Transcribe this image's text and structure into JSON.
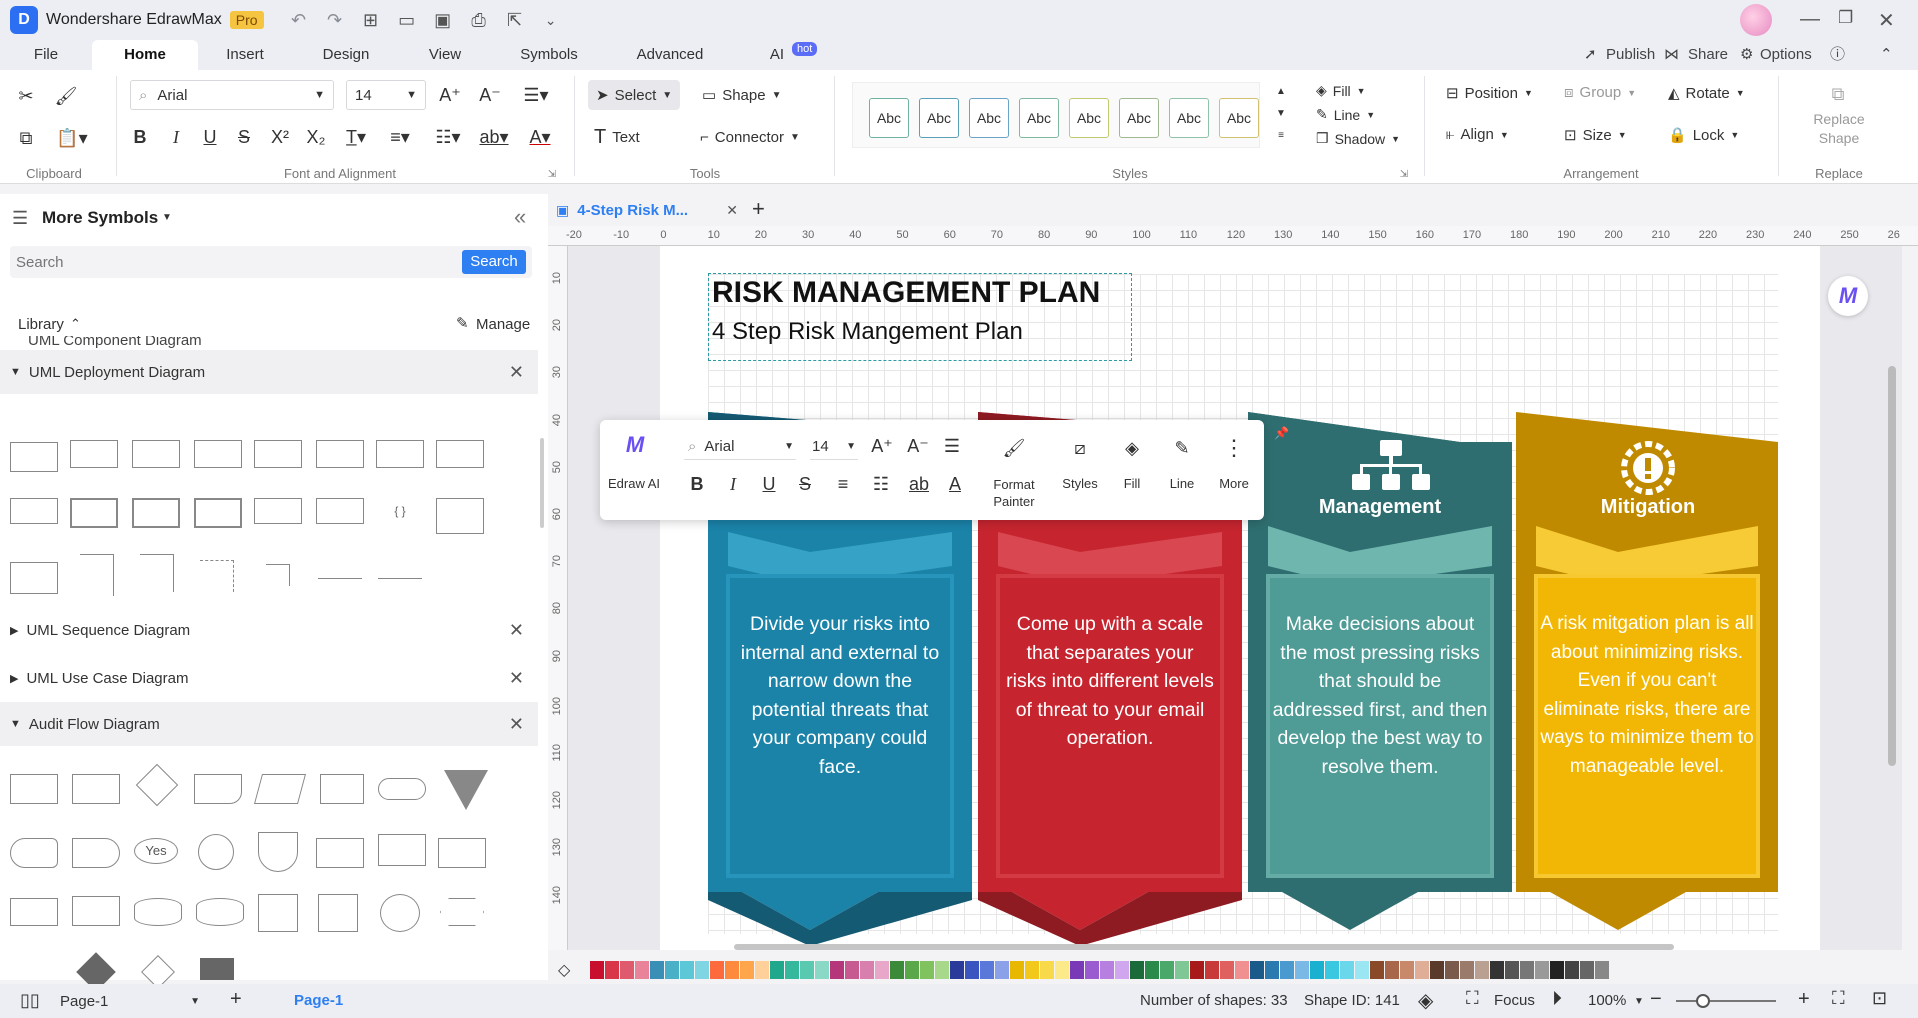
{
  "app": {
    "name": "Wondershare EdrawMax",
    "badge": "Pro"
  },
  "menu": {
    "tabs": [
      "File",
      "Home",
      "Insert",
      "Design",
      "View",
      "Symbols",
      "Advanced",
      "AI"
    ],
    "active": "Home",
    "ai_badge": "hot",
    "right": {
      "publish": "Publish",
      "share": "Share",
      "options": "Options"
    }
  },
  "ribbon": {
    "font_name": "Arial",
    "font_size": "14",
    "select": "Select",
    "shape": "Shape",
    "text": "Text",
    "connector": "Connector",
    "style_sample": "Abc",
    "fill": "Fill",
    "line": "Line",
    "shadow": "Shadow",
    "position": "Position",
    "group": "Group",
    "rotate": "Rotate",
    "align": "Align",
    "size": "Size",
    "lock": "Lock",
    "replace_shape": "Replace Shape",
    "groups": {
      "clipboard": "Clipboard",
      "font": "Font and Alignment",
      "tools": "Tools",
      "styles": "Styles",
      "arrangement": "Arrangement",
      "replace": "Replace"
    }
  },
  "left_panel": {
    "title": "More Symbols",
    "search_placeholder": "Search",
    "search_button": "Search",
    "library": "Library",
    "manage": "Manage",
    "partial_item": "UML Component Diagram",
    "categories": [
      {
        "label": "UML Deployment Diagram",
        "open": true
      },
      {
        "label": "UML Sequence Diagram",
        "open": false
      },
      {
        "label": "UML Use Case Diagram",
        "open": false
      },
      {
        "label": "Audit Flow Diagram",
        "open": true
      }
    ],
    "yes_shape": "Yes"
  },
  "document": {
    "tab_title": "4-Step Risk M...",
    "ruler_h": [
      "-20",
      "-10",
      "0",
      "10",
      "20",
      "30",
      "40",
      "50",
      "60",
      "70",
      "80",
      "90",
      "100",
      "110",
      "120",
      "130",
      "140",
      "150",
      "160",
      "170",
      "180",
      "190",
      "200",
      "210",
      "220",
      "230",
      "240",
      "250",
      "26"
    ],
    "ruler_v": [
      "10",
      "20",
      "30",
      "40",
      "50",
      "60",
      "70",
      "80",
      "90",
      "100",
      "110",
      "120",
      "130",
      "140"
    ],
    "title": "RISK MANAGEMENT PLAN",
    "subtitle": "4 Step Risk Mangement Plan",
    "cards": [
      {
        "color": "#1b83a8",
        "dark": "#145a73",
        "title": "",
        "text": "Divide your risks into internal and external to narrow down the potential threats that your company could face."
      },
      {
        "color": "#c6252f",
        "dark": "#8e1a22",
        "title": "",
        "text": "Come up with a scale that separates your risks into different levels of threat to your email operation."
      },
      {
        "color": "#4f9b96",
        "dark": "#2f6e70",
        "title": "Management",
        "text": "Make decisions about the most pressing risks that should be addressed first, and then develop the best way to resolve them."
      },
      {
        "color": "#f2b705",
        "dark": "#c08a00",
        "title": "Mitigation",
        "text": "A risk mitgation plan is all about minimizing risks. Even if you can't eliminate risks, there are ways to minimize them to manageable level."
      }
    ]
  },
  "float_toolbar": {
    "edraw_ai": "Edraw AI",
    "font": "Arial",
    "size": "14",
    "format_painter": "Format Painter",
    "styles": "Styles",
    "fill": "Fill",
    "line": "Line",
    "more": "More"
  },
  "palette": [
    "#c8102e",
    "#d9364a",
    "#e05a6e",
    "#e8839a",
    "#3a8fb7",
    "#4ab0c8",
    "#5cc7d6",
    "#7fd6e2",
    "#ff6a3d",
    "#ff8a3d",
    "#ffa64d",
    "#ffd09a",
    "#1fa88b",
    "#35b89c",
    "#59c9b0",
    "#8ad9c6",
    "#b5367a",
    "#c85a92",
    "#d97fad",
    "#e8a6c8",
    "#3a8a3a",
    "#5aa84a",
    "#7fc25e",
    "#a8d98a",
    "#2a3a9a",
    "#3a55c0",
    "#5a78d9",
    "#8aa0e8",
    "#e8b800",
    "#f2c81a",
    "#f7d94a",
    "#fbe98a",
    "#7a3ab8",
    "#9a5ad0",
    "#b77fe0",
    "#d0a6ee",
    "#1a6a3a",
    "#2a8a4a",
    "#4aa86a",
    "#7fc896",
    "#a81a1a",
    "#c83a3a",
    "#e06060",
    "#f09090",
    "#1a5a8a",
    "#2a7ab0",
    "#4a9ad0",
    "#7ab8e6",
    "#1ab0d0",
    "#3ac8e0",
    "#6ad8ea",
    "#9ae6f2",
    "#8a4a2a",
    "#a8664a",
    "#c8886a",
    "#e0ae96",
    "#5a3a2a",
    "#7a5a4a",
    "#9a7a6a",
    "#baa090",
    "#333333",
    "#555555",
    "#777777",
    "#999999",
    "#222222",
    "#444444",
    "#666666",
    "#888888"
  ],
  "status": {
    "page_tab": "Page-1",
    "page_active": "Page-1",
    "shapes": "Number of shapes: 33",
    "shape_id": "Shape ID: 141",
    "focus": "Focus",
    "zoom": "100%"
  }
}
